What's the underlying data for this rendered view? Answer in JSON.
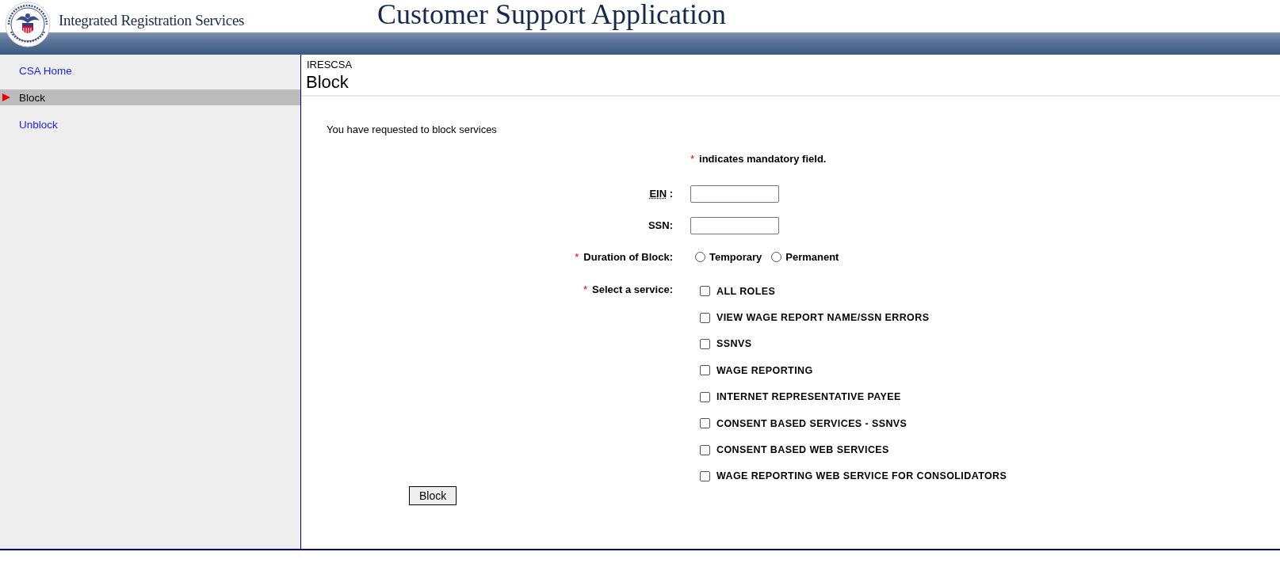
{
  "header": {
    "agency": "Integrated Registration Services",
    "title": "Customer Support Application"
  },
  "sidebar": {
    "items": [
      {
        "label": "CSA Home",
        "selected": false
      },
      {
        "label": "Block",
        "selected": true
      },
      {
        "label": "Unblock",
        "selected": false
      }
    ]
  },
  "page": {
    "code": "IRESCSA",
    "heading": "Block",
    "intro": "You have requested to block services"
  },
  "mandatory_note": {
    "marker": "*",
    "text": "indicates mandatory field."
  },
  "fields": [
    {
      "kind": "text",
      "label": "EIN",
      "abbreviated": true,
      "suffix": " :"
    },
    {
      "kind": "text",
      "label": "SSN:",
      "abbreviated": false
    },
    {
      "kind": "radio",
      "marker": "*",
      "label": "Duration of Block:",
      "options": [
        {
          "label": "Temporary",
          "selected": false
        },
        {
          "label": "Permanent",
          "selected": false
        }
      ]
    },
    {
      "kind": "checkbox",
      "marker": "*",
      "label": "Select a service:",
      "options": [
        {
          "label": "ALL ROLES",
          "checked": false
        },
        {
          "label": "VIEW WAGE REPORT NAME/SSN ERRORS",
          "checked": false
        },
        {
          "label": "SSNVS",
          "checked": false
        },
        {
          "label": "WAGE REPORTING",
          "checked": false
        },
        {
          "label": "INTERNET REPRESENTATIVE PAYEE",
          "checked": false
        },
        {
          "label": "CONSENT BASED SERVICES - SSNVS",
          "checked": false
        },
        {
          "label": "CONSENT BASED WEB SERVICES",
          "checked": false
        },
        {
          "label": "WAGE REPORTING WEB SERVICE FOR CONSOLIDATORS",
          "checked": false
        }
      ]
    }
  ],
  "button": {
    "label": "Block"
  }
}
